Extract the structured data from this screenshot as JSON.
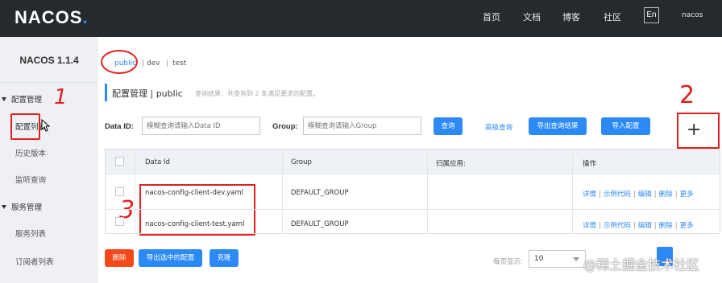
{
  "header": {
    "logo_text": "NACOS",
    "logo_dot": ".",
    "nav": [
      "首页",
      "文档",
      "博客",
      "社区"
    ],
    "language": "En",
    "user": "nacos"
  },
  "sidebar": {
    "version": "NACOS 1.1.4",
    "groups": [
      {
        "label": "配置管理",
        "items": [
          "配置列表",
          "历史版本",
          "监听查询"
        ]
      },
      {
        "label": "服务管理",
        "items": [
          "服务列表",
          "订阅者列表"
        ]
      }
    ]
  },
  "namespaces": {
    "active": "public",
    "separator": "|",
    "others": [
      "dev",
      "test"
    ]
  },
  "page": {
    "title": "配置管理  |  public",
    "result_hint": "查询结果：共查询到 2 条满足要求的配置。"
  },
  "search": {
    "data_id_label": "Data ID:",
    "data_id_placeholder": "模糊查询请输入Data ID",
    "group_label": "Group:",
    "group_placeholder": "模糊查询请输入Group",
    "query_button": "查询",
    "advanced_link": "高级查询",
    "export_button": "导出查询结果",
    "import_button": "导入配置",
    "add_button": "+"
  },
  "table": {
    "columns": [
      "Data Id",
      "Group",
      "归属应用:",
      "操作"
    ],
    "rows": [
      {
        "data_id": "nacos-config-client-dev.yaml",
        "group": "DEFAULT_GROUP",
        "app": ""
      },
      {
        "data_id": "nacos-config-client-test.yaml",
        "group": "DEFAULT_GROUP",
        "app": ""
      }
    ],
    "actions": [
      "详情",
      "示例代码",
      "编辑",
      "删除",
      "更多"
    ]
  },
  "footer": {
    "delete_button": "删除",
    "export_selected_button": "导出选中的配置",
    "clone_button": "克隆",
    "page_size_label": "每页显示:",
    "page_size": "10"
  },
  "annotations": [
    "1",
    "2",
    "3"
  ],
  "watermark": "@稀土掘金技术社区",
  "colors": {
    "header_bg": "#252a2f",
    "accent": "#2b8af7",
    "danger": "#f5491b",
    "annotation": "#e02020",
    "sidebar_bg": "#eef0f3"
  }
}
